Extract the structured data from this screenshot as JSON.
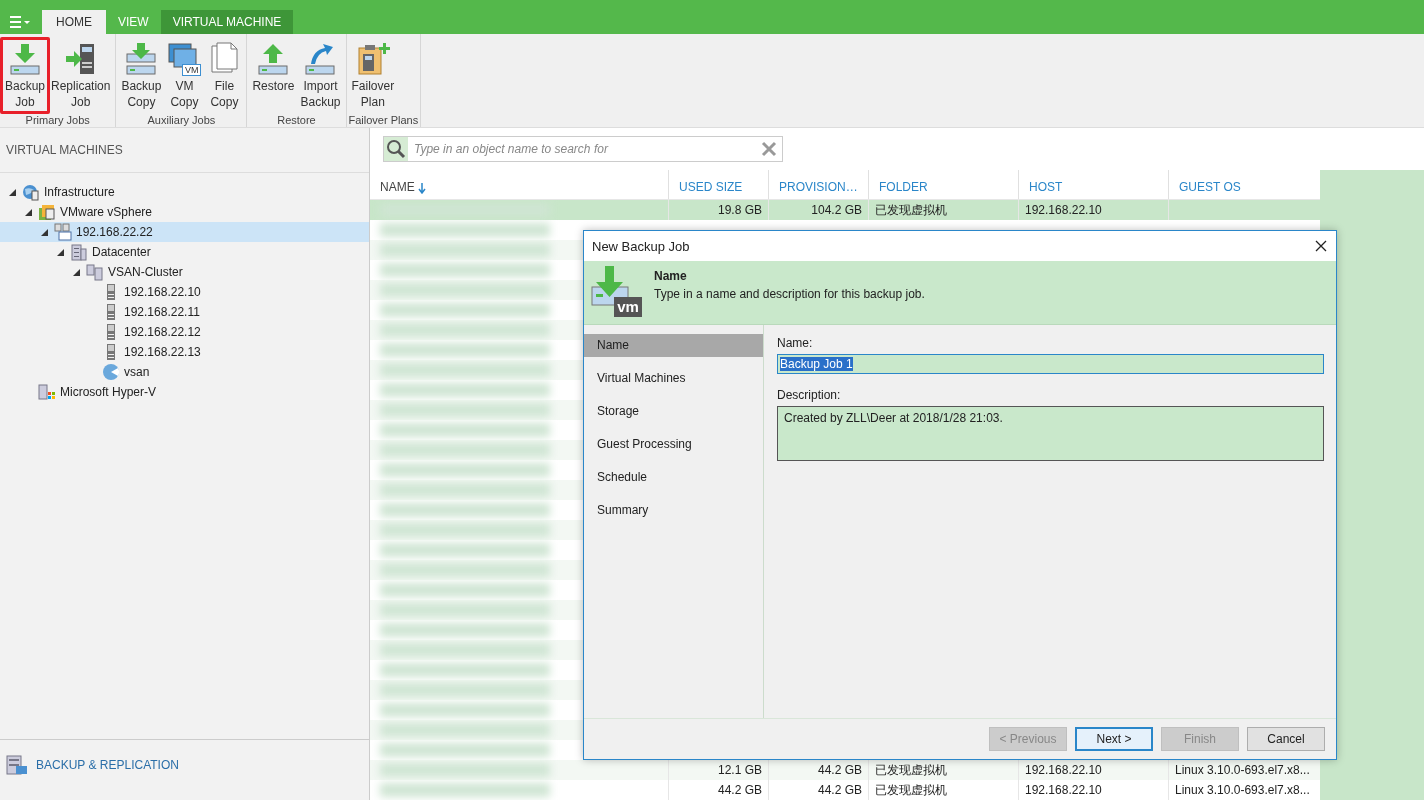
{
  "tabs": [
    {
      "label": "HOME",
      "selected": true,
      "kind": "plain"
    },
    {
      "label": "VIEW",
      "selected": false,
      "kind": "plain"
    },
    {
      "label": "VIRTUAL MACHINE",
      "selected": false,
      "kind": "context"
    }
  ],
  "ribbon_groups": [
    {
      "label": "Primary Jobs",
      "buttons": [
        {
          "lines": [
            "Backup",
            "Job"
          ],
          "kind": "backup",
          "highlighted": true
        },
        {
          "lines": [
            "Replication",
            "Job"
          ],
          "kind": "replication",
          "highlighted": false
        }
      ]
    },
    {
      "label": "Auxiliary Jobs",
      "buttons": [
        {
          "lines": [
            "Backup",
            "Copy"
          ],
          "kind": "backup_copy",
          "highlighted": false
        },
        {
          "lines": [
            "VM",
            "Copy"
          ],
          "kind": "vm_copy",
          "icon_text": "VM",
          "highlighted": false
        },
        {
          "lines": [
            "File",
            "Copy"
          ],
          "kind": "file_copy",
          "highlighted": false
        }
      ]
    },
    {
      "label": "Restore",
      "buttons": [
        {
          "lines": [
            "Restore"
          ],
          "kind": "restore",
          "highlighted": false
        },
        {
          "lines": [
            "Import",
            "Backup"
          ],
          "kind": "import",
          "highlighted": false
        }
      ]
    },
    {
      "label": "Failover Plans",
      "buttons": [
        {
          "lines": [
            "Failover",
            "Plan"
          ],
          "kind": "failover",
          "highlighted": false
        }
      ]
    }
  ],
  "sidebar": {
    "title": "VIRTUAL MACHINES",
    "tree": [
      {
        "label": "Infrastructure",
        "kind": "globe",
        "expanded": true,
        "selected": false,
        "children": [
          {
            "label": "VMware vSphere",
            "kind": "vsphere",
            "expanded": true,
            "selected": false,
            "children": [
              {
                "label": "192.168.22.22",
                "kind": "vcenter",
                "expanded": true,
                "selected": true,
                "children": [
                  {
                    "label": "Datacenter",
                    "kind": "datacenter",
                    "expanded": true,
                    "selected": false,
                    "children": [
                      {
                        "label": "VSAN-Cluster",
                        "kind": "cluster",
                        "expanded": true,
                        "selected": false,
                        "children": [
                          {
                            "label": "192.168.22.10",
                            "kind": "host",
                            "expanded": false,
                            "selected": false
                          },
                          {
                            "label": "192.168.22.11",
                            "kind": "host",
                            "expanded": false,
                            "selected": false
                          },
                          {
                            "label": "192.168.22.12",
                            "kind": "host",
                            "expanded": false,
                            "selected": false
                          },
                          {
                            "label": "192.168.22.13",
                            "kind": "host",
                            "expanded": false,
                            "selected": false
                          },
                          {
                            "label": "vsan",
                            "kind": "datastore",
                            "expanded": false,
                            "selected": false
                          }
                        ]
                      }
                    ]
                  }
                ]
              }
            ]
          },
          {
            "label": "Microsoft Hyper-V",
            "kind": "hyperv",
            "expanded": false,
            "selected": false
          }
        ]
      }
    ]
  },
  "nav": [
    {
      "label": "BACKUP & REPLICATION"
    }
  ],
  "search": {
    "placeholder": "Type in an object name to search for"
  },
  "table": {
    "columns": [
      {
        "label": "NAME",
        "sorted": true
      },
      {
        "label": "USED SIZE",
        "sorted": false
      },
      {
        "label": "PROVISION…",
        "sorted": false
      },
      {
        "label": "FOLDER",
        "sorted": false
      },
      {
        "label": "HOST",
        "sorted": false
      },
      {
        "label": "GUEST OS",
        "sorted": false
      }
    ],
    "top_rows": [
      {
        "used": "19.8 GB",
        "provisioned": "104.2 GB",
        "folder": "已发现虚拟机",
        "host": "192.168.22.10",
        "guest_os": "",
        "selected": true
      }
    ],
    "bottom_rows": [
      {
        "used": "12.1 GB",
        "provisioned": "44.2 GB",
        "folder": "已发现虚拟机",
        "host": "192.168.22.10",
        "guest_os": "Linux 3.10.0-693.el7.x8...",
        "selected": false
      },
      {
        "used": "44.2 GB",
        "provisioned": "44.2 GB",
        "folder": "已发现虚拟机",
        "host": "192.168.22.10",
        "guest_os": "Linux 3.10.0-693.el7.x8...",
        "selected": false
      }
    ]
  },
  "dialog": {
    "title": "New Backup Job",
    "header": {
      "icon_text": "vm",
      "title": "Name",
      "description": "Type in a name and description for this backup job."
    },
    "steps": [
      {
        "label": "Name",
        "selected": true
      },
      {
        "label": "Virtual Machines",
        "selected": false
      },
      {
        "label": "Storage",
        "selected": false
      },
      {
        "label": "Guest Processing",
        "selected": false
      },
      {
        "label": "Schedule",
        "selected": false
      },
      {
        "label": "Summary",
        "selected": false
      }
    ],
    "name_field": {
      "label": "Name:",
      "value": "Backup Job 1",
      "text_selected": true
    },
    "description_field": {
      "label": "Description:",
      "value": "Created by ZLL\\Deer at 2018/1/28 21:03."
    },
    "buttons": [
      {
        "label": "< Previous",
        "disabled": true,
        "default": false
      },
      {
        "label": "Next >",
        "disabled": false,
        "default": true
      },
      {
        "label": "Finish",
        "disabled": true,
        "default": false
      },
      {
        "label": "Cancel",
        "disabled": false,
        "default": false
      }
    ]
  }
}
